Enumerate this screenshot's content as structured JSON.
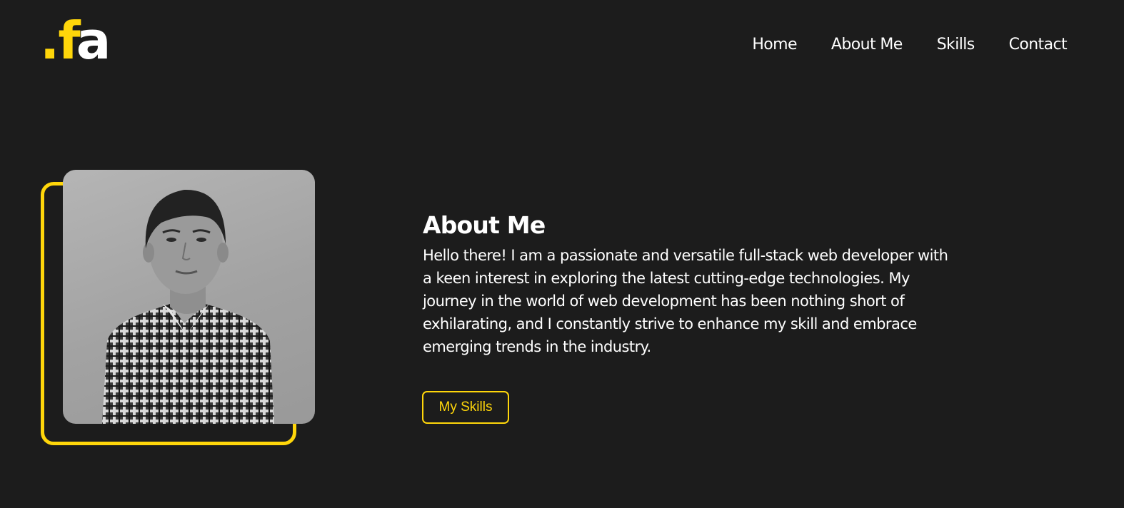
{
  "header": {
    "logo": {
      "dot": ".",
      "letter1": "f",
      "letter2": "a"
    },
    "nav": [
      {
        "label": "Home"
      },
      {
        "label": "About Me"
      },
      {
        "label": "Skills"
      },
      {
        "label": "Contact"
      }
    ]
  },
  "about": {
    "title": "About Me",
    "body": "Hello there! I am a passionate and versatile full-stack web developer with a keen interest in exploring the latest cutting-edge technologies. My journey in the world of web development has been nothing short of exhilarating, and I constantly strive to enhance my skill and embrace emerging trends in the industry.",
    "button_label": "My Skills"
  },
  "colors": {
    "background": "#1c1c1c",
    "accent": "#ffd60a",
    "text": "#ffffff"
  }
}
